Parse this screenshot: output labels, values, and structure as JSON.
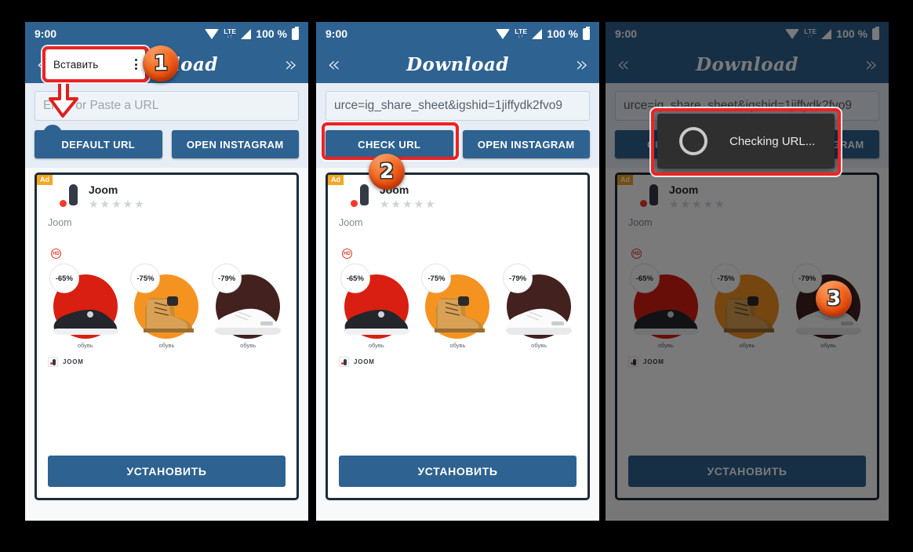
{
  "statusbar": {
    "time": "9:00",
    "network_label": "LTE",
    "network_arrows": "↓↑",
    "battery_percent": "100 %"
  },
  "appbar": {
    "back_icon": "«",
    "forward_icon": "»",
    "title": "Download"
  },
  "panels": [
    {
      "id": "panel-1",
      "url_value": "Enter or Paste a URL",
      "url_is_placeholder": true,
      "primary_button": "DEFAULT URL",
      "secondary_button": "OPEN INSTAGRAM",
      "paste_popup": {
        "label": "Вставить",
        "menu_icon": "kebab-menu"
      },
      "step_number": "1"
    },
    {
      "id": "panel-2",
      "url_value": "urce=ig_share_sheet&igshid=1jiffydk2fvo9",
      "url_is_placeholder": false,
      "primary_button": "CHECK URL",
      "secondary_button": "OPEN INSTAGRAM",
      "step_number": "2"
    },
    {
      "id": "panel-3",
      "url_value": "urce=ig_share_sheet&igshid=1jiffydk2fvo9",
      "url_is_placeholder": false,
      "primary_button": "CHECK URL",
      "secondary_button": "OPEN INSTAGRAM",
      "toast": {
        "message": "Checking URL...",
        "spinner": "loading-spinner"
      },
      "step_number": "3"
    }
  ],
  "ad": {
    "badge": "Ad",
    "app_name": "Joom",
    "rating_stars": "★★★★★",
    "subtitle": "Joom",
    "hd_badge": "HD",
    "products": [
      {
        "discount": "-65%",
        "caption": "обувь",
        "blob_color": "#d81f11",
        "shoe": "black-sneaker"
      },
      {
        "discount": "-75%",
        "caption": "обувь",
        "blob_color": "#f59321",
        "shoe": "tan-boot"
      },
      {
        "discount": "-79%",
        "caption": "обувь",
        "blob_color": "#42211f",
        "shoe": "white-sneaker"
      }
    ],
    "footer_brand": "JOOM",
    "install_button": "УСТАНОВИТЬ"
  },
  "colors": {
    "appbar": "#2e6291",
    "form_bg": "#e6edf5",
    "highlight_ring": "#ee2222",
    "badge_orange": "#f4651c",
    "ad_badge": "#f5a623"
  }
}
